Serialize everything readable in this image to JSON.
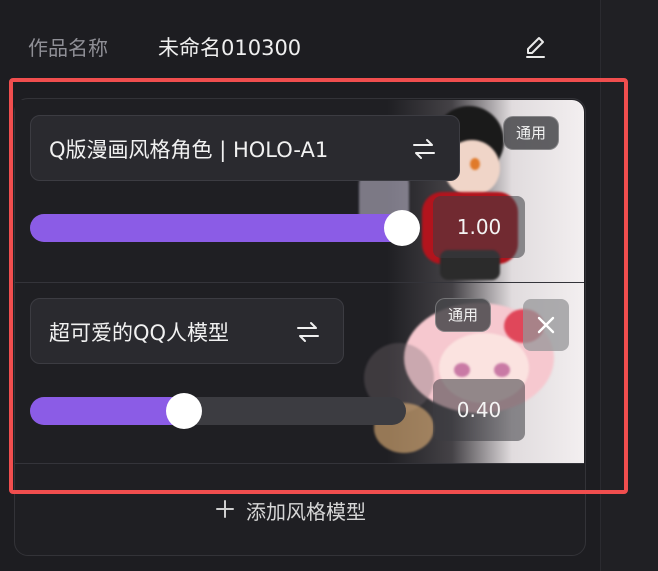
{
  "header": {
    "label": "作品名称",
    "name": "未命名010300"
  },
  "models": [
    {
      "name": "Q版漫画风格角色 | HOLO-A1",
      "badge": "通用",
      "value": "1.00",
      "weight": 1.0
    },
    {
      "name": "超可爱的QQ人模型",
      "badge": "通用",
      "value": "0.40",
      "weight": 0.4
    }
  ],
  "add_button": {
    "label": "添加风格模型"
  },
  "colors": {
    "accent": "#8b5ce6",
    "highlight_frame": "#f04e4e",
    "background": "#1d1d21"
  }
}
